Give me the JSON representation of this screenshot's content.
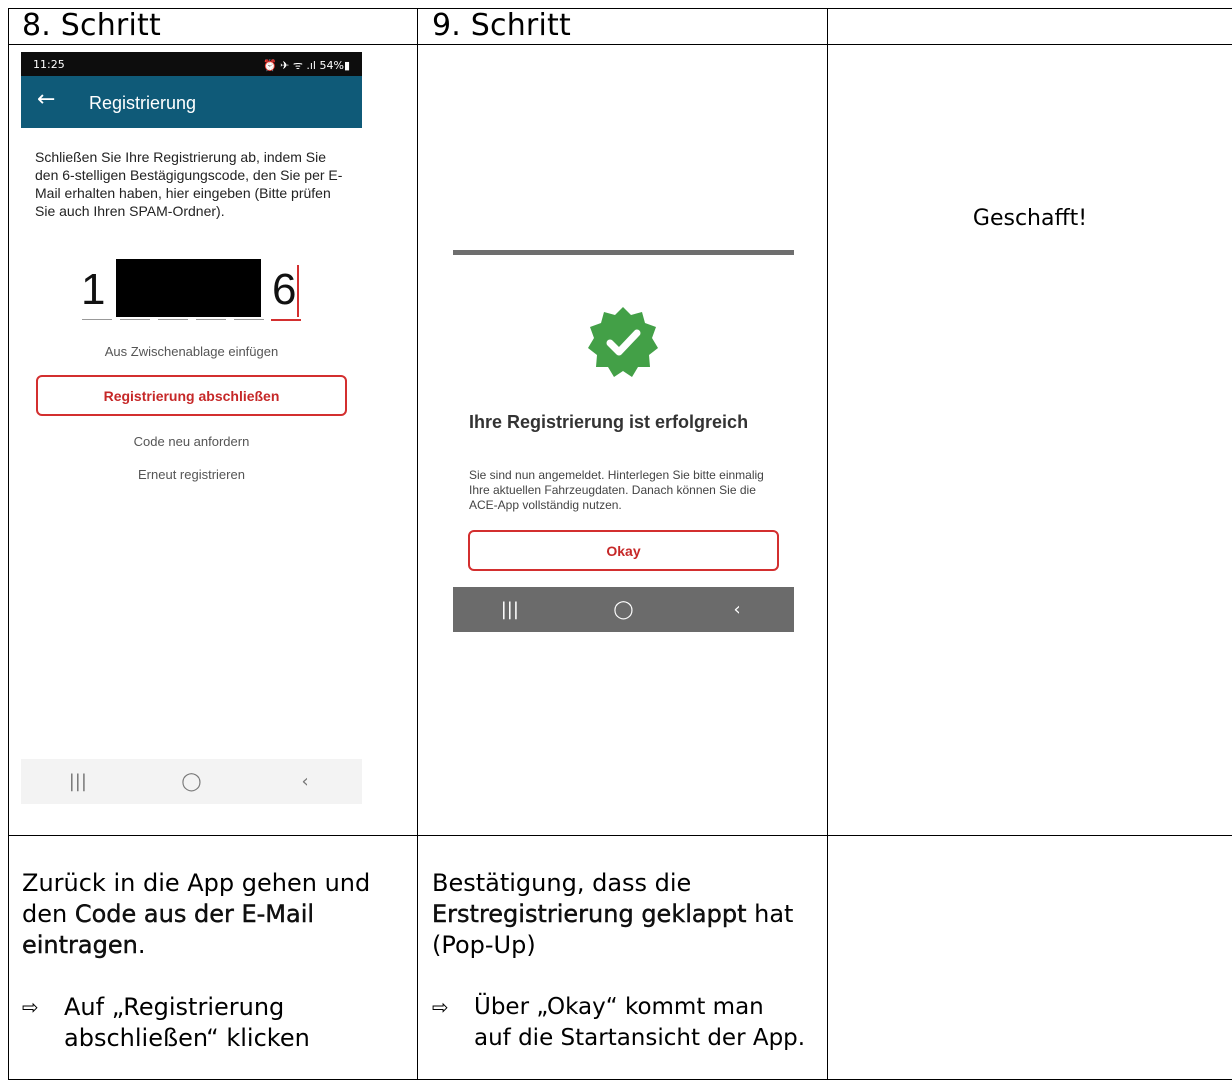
{
  "columns": {
    "col1_header": "8. Schritt",
    "col2_header": "9. Schritt",
    "col3_header": ""
  },
  "phone1": {
    "status_time": "11:25",
    "status_icons": "⏰ ✈ ᯤ .ıl 54%▮",
    "appbar_title": "Registrierung",
    "instruction": "Schließen Sie Ihre Registrierung ab, indem Sie den 6-stelligen Bestägigungscode, den Sie per E-Mail erhalten haben, hier eingeben (Bitte prüfen Sie auch Ihren SPAM-Ordner).",
    "code_first_digit": "1",
    "code_last_digit": "6",
    "paste_link": "Aus Zwischenablage einfügen",
    "finish_button": "Registrierung abschließen",
    "resend_code": "Code neu anfordern",
    "register_again": "Erneut registrieren"
  },
  "phone2": {
    "title": "Ihre Registrierung ist erfolgreich",
    "message": "Sie sind nun angemeldet. Hinterlegen Sie bitte einmalig Ihre aktuellen Fahrzeugdaten. Danach können Sie die ACE-App vollständig nutzen.",
    "okay_button": "Okay"
  },
  "nav": {
    "recents": "|||",
    "home": "◯",
    "back": "‹"
  },
  "col3_text": "Geschafft!",
  "descriptions": {
    "col1_line1": "Zurück in die App gehen und",
    "col1_line2_pre": "den ",
    "col1_line2_bold": "Code aus der E-Mail",
    "col1_line3_bold": "eintragen",
    "col1_line3_post": ".",
    "col1_bullet_line1": "Auf „Registrierung",
    "col1_bullet_line2": "abschließen“ klicken",
    "col2_line1": "Bestätigung, dass die",
    "col2_line2_bold": "Erstregistrierung geklappt",
    "col2_line2_post": " hat",
    "col2_line3": "(Pop-Up)",
    "col2_bullet_line1": "Über „Okay“ kommt man",
    "col2_bullet_line2": "auf die Startansicht der App.",
    "bullet_arrow": "⇨"
  },
  "colors": {
    "appbar": "#0f5a78",
    "accent_red": "#d32f2f",
    "badge_green": "#43a047",
    "nav_dark": "#6b6b6b"
  }
}
